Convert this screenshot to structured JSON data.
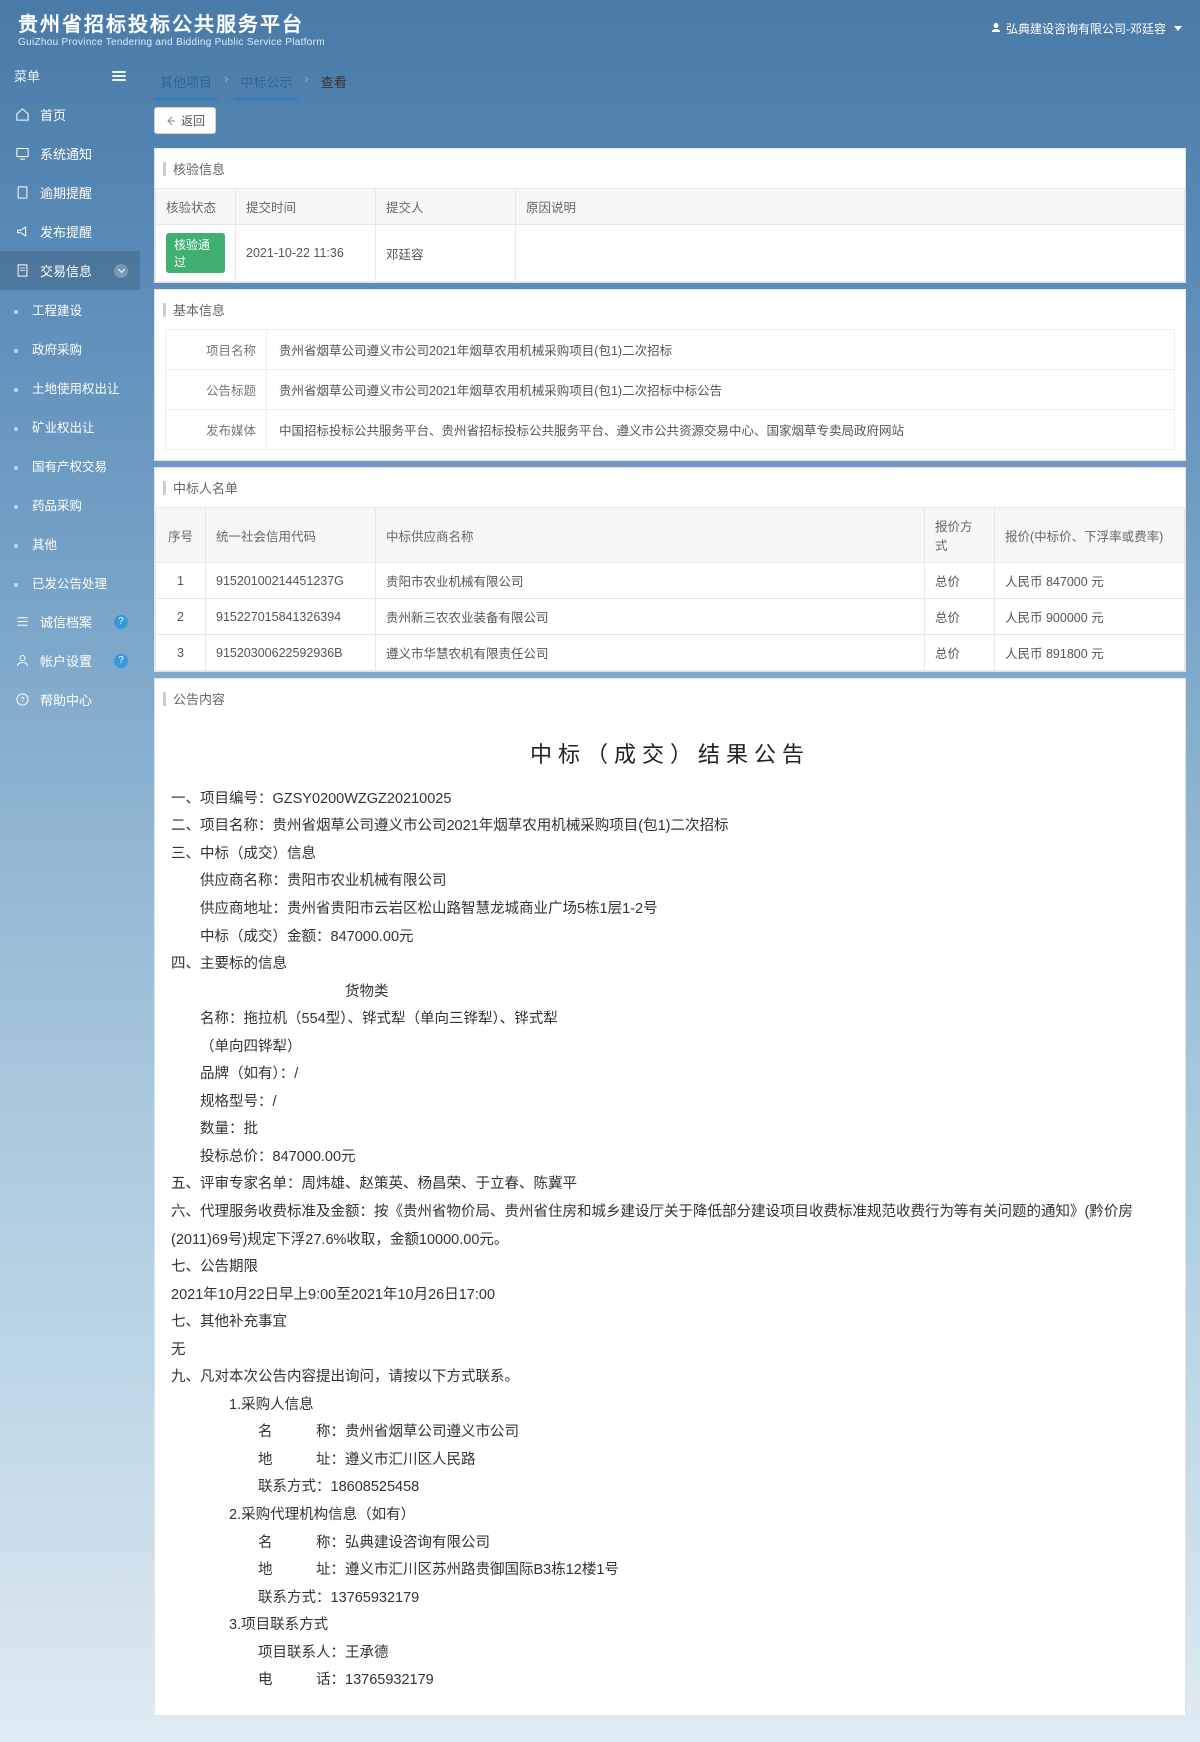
{
  "header": {
    "title_cn": "贵州省招标投标公共服务平台",
    "title_en": "GuiZhou Province Tendering and Bidding Public Service Platform",
    "user": "弘典建设咨询有限公司-邓廷容"
  },
  "sidebar": {
    "menu_label": "菜单",
    "items": [
      {
        "label": "首页",
        "icon": "home"
      },
      {
        "label": "系统通知",
        "icon": "monitor"
      },
      {
        "label": "逾期提醒",
        "icon": "book"
      },
      {
        "label": "发布提醒",
        "icon": "bell"
      },
      {
        "label": "交易信息",
        "icon": "doc",
        "active": true,
        "expand": true
      },
      {
        "label": "诚信档案",
        "icon": "list",
        "badge": "?"
      },
      {
        "label": "帐户设置",
        "icon": "user",
        "badge": "?"
      },
      {
        "label": "帮助中心",
        "icon": "help"
      }
    ],
    "sub": [
      {
        "label": "工程建设"
      },
      {
        "label": "政府采购"
      },
      {
        "label": "土地使用权出让"
      },
      {
        "label": "矿业权出让"
      },
      {
        "label": "国有产权交易"
      },
      {
        "label": "药品采购"
      },
      {
        "label": "其他"
      },
      {
        "label": "已发公告处理"
      }
    ]
  },
  "breadcrumb": {
    "a": "其他项目",
    "b": "中标公示",
    "c": "查看"
  },
  "back_label": "返回",
  "panels": {
    "verify_title": "核验信息",
    "basic_title": "基本信息",
    "winners_title": "中标人名单",
    "article_title": "公告内容"
  },
  "verify": {
    "cols": {
      "status": "核验状态",
      "time": "提交时间",
      "submitter": "提交人",
      "reason": "原因说明"
    },
    "row": {
      "status": "核验通过",
      "time": "2021-10-22 11:36",
      "submitter": "邓廷容",
      "reason": ""
    }
  },
  "basic": {
    "labels": {
      "proj": "项目名称",
      "ann": "公告标题",
      "media": "发布媒体"
    },
    "proj": "贵州省烟草公司遵义市公司2021年烟草农用机械采购项目(包1)二次招标",
    "ann": "贵州省烟草公司遵义市公司2021年烟草农用机械采购项目(包1)二次招标中标公告",
    "media": "中国招标投标公共服务平台、贵州省招标投标公共服务平台、遵义市公共资源交易中心、国家烟草专卖局政府网站"
  },
  "winners": {
    "cols": {
      "seq": "序号",
      "code": "统一社会信用代码",
      "name": "中标供应商名称",
      "method": "报价方式",
      "price": "报价(中标价、下浮率或费率)"
    },
    "rows": [
      {
        "seq": "1",
        "code": "91520100214451237G",
        "name": "贵阳市农业机械有限公司",
        "method": "总价",
        "price": "人民币 847000 元"
      },
      {
        "seq": "2",
        "code": "915227015841326394",
        "name": "贵州新三农农业装备有限公司",
        "method": "总价",
        "price": "人民币 900000 元"
      },
      {
        "seq": "3",
        "code": "91520300622592936B",
        "name": "遵义市华慧农机有限责任公司",
        "method": "总价",
        "price": "人民币 891800 元"
      }
    ]
  },
  "article": {
    "heading": "中标（成交）结果公告",
    "l1": "一、项目编号：GZSY0200WZGZ20210025",
    "l2": "二、项目名称：贵州省烟草公司遵义市公司2021年烟草农用机械采购项目(包1)二次招标",
    "l3": "三、中标（成交）信息",
    "l3a": "供应商名称：贵阳市农业机械有限公司",
    "l3b": "供应商地址：贵州省贵阳市云岩区松山路智慧龙城商业广场5栋1层1-2号",
    "l3c": "中标（成交）金额：847000.00元",
    "l4": "四、主要标的信息",
    "l4_goods": "货物类",
    "l4a": "名称：拖拉机（554型）、铧式犁（单向三铧犁）、铧式犁",
    "l4a2": "（单向四铧犁）",
    "l4b": "品牌（如有）：/",
    "l4c": "规格型号：/",
    "l4d": "数量：批",
    "l4e": "投标总价：847000.00元",
    "l5": "五、评审专家名单：周炜雄、赵策英、杨昌荣、于立春、陈冀平",
    "l6": "六、代理服务收费标准及金额：按《贵州省物价局、贵州省住房和城乡建设厅关于降低部分建设项目收费标准规范收费行为等有关问题的通知》(黔价房(2011)69号)规定下浮27.6%收取，金额10000.00元。",
    "l7": "七、公告期限",
    "l7a": "2021年10月22日早上9:00至2021年10月26日17:00",
    "l7b": "七、其他补充事宜",
    "l7c": "无",
    "l9": "九、凡对本次公告内容提出询问，请按以下方式联系。",
    "l9_1": "1.采购人信息",
    "l9_1a": "名　　　称：贵州省烟草公司遵义市公司",
    "l9_1b": "地　　　址：遵义市汇川区人民路",
    "l9_1c": "联系方式：18608525458",
    "l9_2": "2.采购代理机构信息（如有）",
    "l9_2a": "名　　　称：弘典建设咨询有限公司",
    "l9_2b": "地　　　址：遵义市汇川区苏州路贵御国际B3栋12楼1号",
    "l9_2c": "联系方式：13765932179",
    "l9_3": "3.项目联系方式",
    "l9_3a": "项目联系人：王承德",
    "l9_3b": "电　　　话：13765932179"
  }
}
